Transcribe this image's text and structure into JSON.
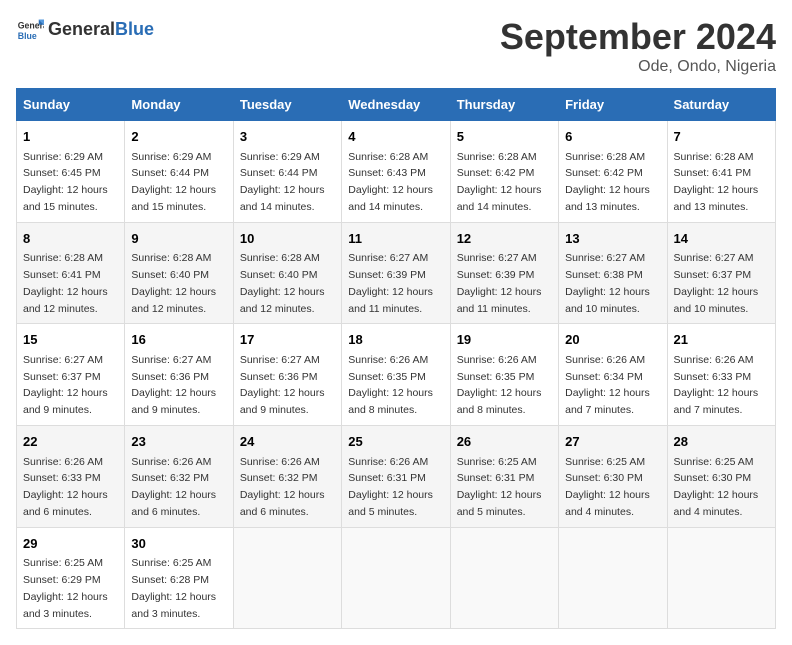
{
  "logo": {
    "general": "General",
    "blue": "Blue"
  },
  "title": "September 2024",
  "location": "Ode, Ondo, Nigeria",
  "days_of_week": [
    "Sunday",
    "Monday",
    "Tuesday",
    "Wednesday",
    "Thursday",
    "Friday",
    "Saturday"
  ],
  "weeks": [
    [
      {
        "day": "1",
        "sunrise": "6:29 AM",
        "sunset": "6:45 PM",
        "daylight": "12 hours and 15 minutes."
      },
      {
        "day": "2",
        "sunrise": "6:29 AM",
        "sunset": "6:44 PM",
        "daylight": "12 hours and 15 minutes."
      },
      {
        "day": "3",
        "sunrise": "6:29 AM",
        "sunset": "6:44 PM",
        "daylight": "12 hours and 14 minutes."
      },
      {
        "day": "4",
        "sunrise": "6:28 AM",
        "sunset": "6:43 PM",
        "daylight": "12 hours and 14 minutes."
      },
      {
        "day": "5",
        "sunrise": "6:28 AM",
        "sunset": "6:42 PM",
        "daylight": "12 hours and 14 minutes."
      },
      {
        "day": "6",
        "sunrise": "6:28 AM",
        "sunset": "6:42 PM",
        "daylight": "12 hours and 13 minutes."
      },
      {
        "day": "7",
        "sunrise": "6:28 AM",
        "sunset": "6:41 PM",
        "daylight": "12 hours and 13 minutes."
      }
    ],
    [
      {
        "day": "8",
        "sunrise": "6:28 AM",
        "sunset": "6:41 PM",
        "daylight": "12 hours and 12 minutes."
      },
      {
        "day": "9",
        "sunrise": "6:28 AM",
        "sunset": "6:40 PM",
        "daylight": "12 hours and 12 minutes."
      },
      {
        "day": "10",
        "sunrise": "6:28 AM",
        "sunset": "6:40 PM",
        "daylight": "12 hours and 12 minutes."
      },
      {
        "day": "11",
        "sunrise": "6:27 AM",
        "sunset": "6:39 PM",
        "daylight": "12 hours and 11 minutes."
      },
      {
        "day": "12",
        "sunrise": "6:27 AM",
        "sunset": "6:39 PM",
        "daylight": "12 hours and 11 minutes."
      },
      {
        "day": "13",
        "sunrise": "6:27 AM",
        "sunset": "6:38 PM",
        "daylight": "12 hours and 10 minutes."
      },
      {
        "day": "14",
        "sunrise": "6:27 AM",
        "sunset": "6:37 PM",
        "daylight": "12 hours and 10 minutes."
      }
    ],
    [
      {
        "day": "15",
        "sunrise": "6:27 AM",
        "sunset": "6:37 PM",
        "daylight": "12 hours and 9 minutes."
      },
      {
        "day": "16",
        "sunrise": "6:27 AM",
        "sunset": "6:36 PM",
        "daylight": "12 hours and 9 minutes."
      },
      {
        "day": "17",
        "sunrise": "6:27 AM",
        "sunset": "6:36 PM",
        "daylight": "12 hours and 9 minutes."
      },
      {
        "day": "18",
        "sunrise": "6:26 AM",
        "sunset": "6:35 PM",
        "daylight": "12 hours and 8 minutes."
      },
      {
        "day": "19",
        "sunrise": "6:26 AM",
        "sunset": "6:35 PM",
        "daylight": "12 hours and 8 minutes."
      },
      {
        "day": "20",
        "sunrise": "6:26 AM",
        "sunset": "6:34 PM",
        "daylight": "12 hours and 7 minutes."
      },
      {
        "day": "21",
        "sunrise": "6:26 AM",
        "sunset": "6:33 PM",
        "daylight": "12 hours and 7 minutes."
      }
    ],
    [
      {
        "day": "22",
        "sunrise": "6:26 AM",
        "sunset": "6:33 PM",
        "daylight": "12 hours and 6 minutes."
      },
      {
        "day": "23",
        "sunrise": "6:26 AM",
        "sunset": "6:32 PM",
        "daylight": "12 hours and 6 minutes."
      },
      {
        "day": "24",
        "sunrise": "6:26 AM",
        "sunset": "6:32 PM",
        "daylight": "12 hours and 6 minutes."
      },
      {
        "day": "25",
        "sunrise": "6:26 AM",
        "sunset": "6:31 PM",
        "daylight": "12 hours and 5 minutes."
      },
      {
        "day": "26",
        "sunrise": "6:25 AM",
        "sunset": "6:31 PM",
        "daylight": "12 hours and 5 minutes."
      },
      {
        "day": "27",
        "sunrise": "6:25 AM",
        "sunset": "6:30 PM",
        "daylight": "12 hours and 4 minutes."
      },
      {
        "day": "28",
        "sunrise": "6:25 AM",
        "sunset": "6:30 PM",
        "daylight": "12 hours and 4 minutes."
      }
    ],
    [
      {
        "day": "29",
        "sunrise": "6:25 AM",
        "sunset": "6:29 PM",
        "daylight": "12 hours and 3 minutes."
      },
      {
        "day": "30",
        "sunrise": "6:25 AM",
        "sunset": "6:28 PM",
        "daylight": "12 hours and 3 minutes."
      },
      null,
      null,
      null,
      null,
      null
    ]
  ]
}
